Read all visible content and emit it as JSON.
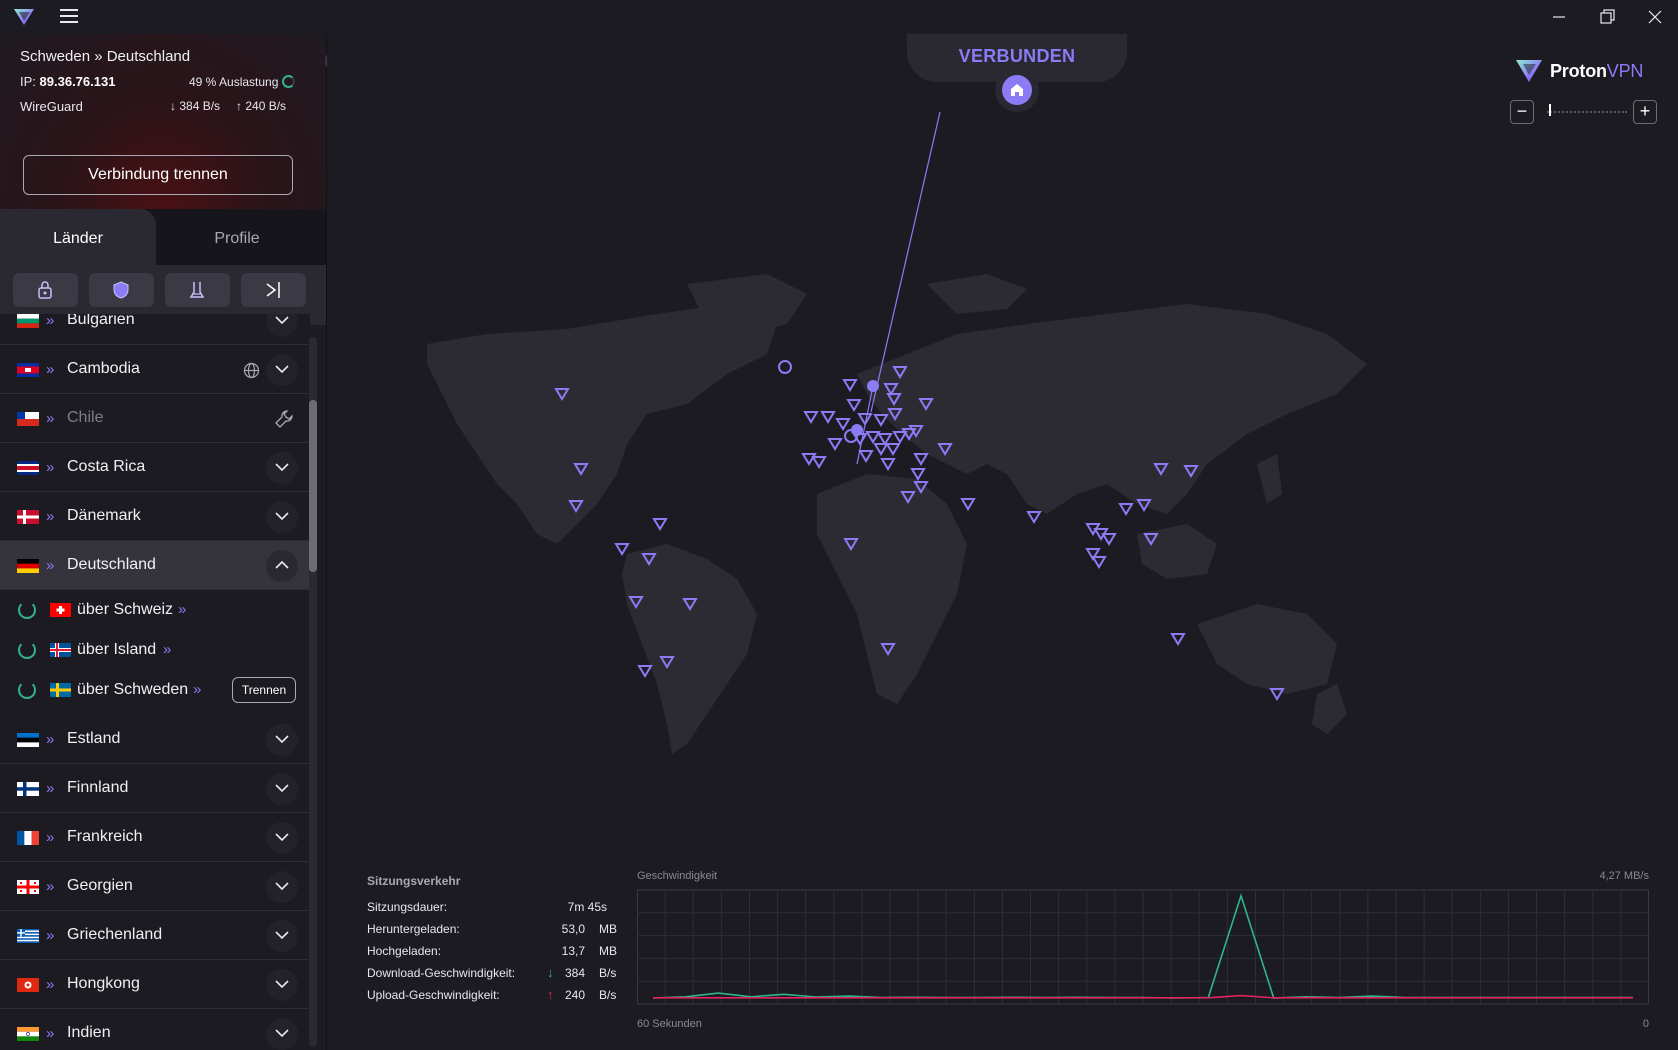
{
  "window": {
    "min_icon": "minimize-icon",
    "max_icon": "restore-icon",
    "close_icon": "close-icon"
  },
  "connection": {
    "route": "Schweden » Deutschland",
    "ip_label": "IP:",
    "ip": "89.36.76.131",
    "load": "49 % Auslastung",
    "protocol": "WireGuard",
    "download": "384 B/s",
    "upload": "240 B/s",
    "disconnect_label": "Verbindung trennen"
  },
  "tabs": [
    {
      "label": "Länder",
      "active": true
    },
    {
      "label": "Profile",
      "active": false
    }
  ],
  "filters": [
    "secure-core-icon",
    "shield-icon",
    "p2p-icon",
    "tor-icon"
  ],
  "countries": [
    {
      "name": "Bulgarien",
      "flag": [
        "#ffffff",
        "#00966e",
        "#d62612"
      ],
      "expandable": true
    },
    {
      "name": "Cambodia",
      "flag": [
        "#032ea1",
        "#e00025",
        "#032ea1"
      ],
      "expandable": true,
      "extra_icon": "globe-icon"
    },
    {
      "name": "Chile",
      "flag": [
        "#ffffff",
        "#d52b1e",
        "#0039a6"
      ],
      "dim": true,
      "extra_icon": "wrench-icon"
    },
    {
      "name": "Costa Rica",
      "flag": [
        "#002b7f",
        "#ce1126",
        "#002b7f"
      ],
      "expandable": true
    },
    {
      "name": "Dänemark",
      "flag": [
        "#c8102e",
        "#ffffff",
        "#c8102e"
      ],
      "expandable": true
    },
    {
      "name": "Deutschland",
      "flag": [
        "#000000",
        "#dd0000",
        "#ffce00"
      ],
      "expanded": true
    },
    {
      "name": "Estland",
      "flag": [
        "#0072ce",
        "#000000",
        "#ffffff"
      ],
      "expandable": true
    },
    {
      "name": "Finnland",
      "flag": [
        "#ffffff",
        "#003580",
        "#ffffff"
      ],
      "expandable": true
    },
    {
      "name": "Frankreich",
      "flag": [
        "#0055a4",
        "#ffffff",
        "#ef4135"
      ],
      "expandable": true
    },
    {
      "name": "Georgien",
      "flag": [
        "#ffffff",
        "#ff0000",
        "#ffffff"
      ],
      "expandable": true
    },
    {
      "name": "Griechenland",
      "flag": [
        "#0d5eaf",
        "#ffffff",
        "#0d5eaf"
      ],
      "expandable": true
    },
    {
      "name": "Hongkong",
      "flag": [
        "#de2910",
        "#ffffff",
        "#de2910"
      ],
      "expandable": true
    },
    {
      "name": "Indien",
      "flag": [
        "#ff9933",
        "#ffffff",
        "#138808"
      ],
      "expandable": true
    }
  ],
  "secure_core_servers": [
    {
      "name": "über Schweiz",
      "flag": [
        "#ff0000",
        "#ffffff",
        "#ff0000"
      ]
    },
    {
      "name": "über Island",
      "flag": [
        "#02529c",
        "#dc1e35",
        "#02529c"
      ]
    },
    {
      "name": "über Schweden",
      "flag": [
        "#006aa7",
        "#fecc02",
        "#006aa7"
      ],
      "action": "Trennen"
    }
  ],
  "status": {
    "label": "VERBUNDEN",
    "home_icon": "home-icon"
  },
  "brand": {
    "name_bold": "Proton",
    "name_light": "VPN"
  },
  "zoom": {
    "minus": "−",
    "plus": "+"
  },
  "session": {
    "title": "Sitzungsverkehr",
    "rows": [
      {
        "label": "Sitzungsdauer:",
        "value": "7m 45s",
        "unit": ""
      },
      {
        "label": "Heruntergeladen:",
        "value": "53,0",
        "unit": "MB"
      },
      {
        "label": "Hochgeladen:",
        "value": "13,7",
        "unit": "MB"
      },
      {
        "label": "Download-Geschwindigkeit:",
        "value": "384",
        "unit": "B/s",
        "arrow": "↓"
      },
      {
        "label": "Upload-Geschwindigkeit:",
        "value": "240",
        "unit": "B/s",
        "arrow": "↑"
      }
    ]
  },
  "chart_data": {
    "type": "line",
    "title": "Geschwindigkeit",
    "xlabel_left": "60 Sekunden",
    "xlabel_right": "0",
    "ymax_label": "4,27 MB/s",
    "ylim": [
      0,
      4.27
    ],
    "x": [
      60,
      58,
      56,
      54,
      52,
      50,
      48,
      46,
      44,
      42,
      40,
      38,
      36,
      34,
      32,
      30,
      28,
      26,
      24,
      22,
      20,
      18,
      16,
      14,
      12,
      10,
      8,
      6,
      4,
      2,
      0
    ],
    "series": [
      {
        "color": "#2fb58c",
        "values": [
          0.0,
          0.05,
          0.2,
          0.05,
          0.15,
          0.04,
          0.08,
          0.02,
          0.03,
          0.02,
          0.02,
          0.03,
          0.02,
          0.03,
          0.02,
          0.02,
          0.0,
          0.02,
          4.2,
          0.0,
          0.05,
          0.02,
          0.08,
          0.02,
          0.02,
          0.02,
          0.02,
          0.02,
          0.02,
          0.02,
          0.02
        ]
      },
      {
        "color": "#e0245e",
        "values": [
          0.01,
          0.01,
          0.01,
          0.01,
          0.01,
          0.01,
          0.01,
          0.01,
          0.01,
          0.01,
          0.01,
          0.01,
          0.01,
          0.01,
          0.01,
          0.01,
          0.01,
          0.01,
          0.1,
          0.01,
          0.01,
          0.01,
          0.01,
          0.01,
          0.01,
          0.01,
          0.01,
          0.01,
          0.01,
          0.01,
          0.01
        ]
      }
    ]
  }
}
